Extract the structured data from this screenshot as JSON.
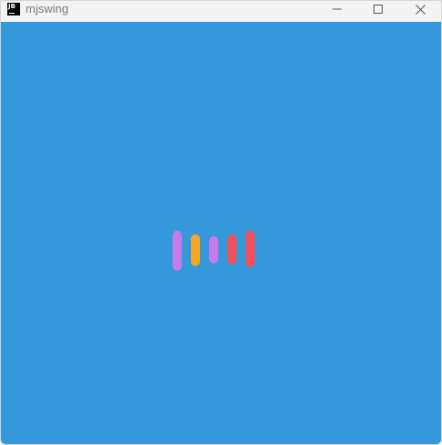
{
  "window": {
    "title": "mjswing",
    "app_icon_text": "JB"
  },
  "colors": {
    "content_background": "#3598db",
    "bar_colors": [
      "#c57bea",
      "#f5a623",
      "#c57bea",
      "#f5505a",
      "#f5505a"
    ]
  },
  "loader": {
    "bar_count": 5
  }
}
